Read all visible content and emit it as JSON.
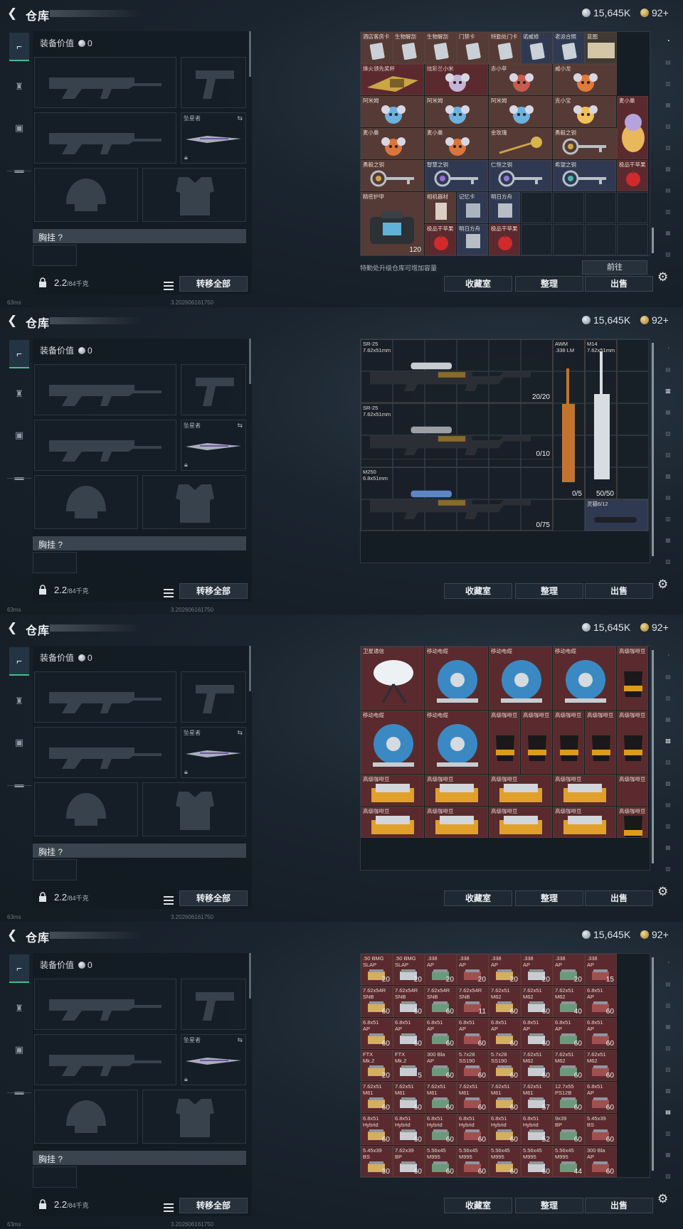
{
  "header": {
    "title": "仓库",
    "silver": "15,645K",
    "gold": "92+"
  },
  "gear": {
    "value_label": "装备价值",
    "value": "0",
    "knife_label": "坠星者",
    "chest_label": "胸挂 ?",
    "weight": "2.2",
    "weight_max": "/84千克",
    "transfer": "转移全部"
  },
  "status": {
    "ping": "63ms",
    "build": "3.202606161750"
  },
  "buttons": {
    "collection": "收藏室",
    "sort": "整理",
    "sell": "出售",
    "goto": "前往"
  },
  "upgrade_note": "特勤处升级仓库可增加容量",
  "views": [
    {
      "items": [
        {
          "n": "酒店客房卡",
          "c": "#563a36"
        },
        {
          "n": "生物解剖",
          "c": "#563a36"
        },
        {
          "n": "生物解剖",
          "c": "#563a36"
        },
        {
          "n": "门禁卡",
          "c": "#563a36"
        },
        {
          "n": "特勤处门卡",
          "c": "#563a36"
        },
        {
          "n": "诺威修",
          "c": "#2f3a52"
        },
        {
          "n": "老派合照",
          "c": "#2f3a52"
        },
        {
          "n": "蓝图",
          "c": "#3f3b33"
        },
        {
          "n": "烽火领先奖杯",
          "c": "#5a2a2e"
        },
        {
          "n": "炫彩兰小米",
          "c": "#5a2a2e"
        },
        {
          "n": "赤小苹",
          "c": "#563a36"
        },
        {
          "n": "威小龙",
          "c": "#563a36"
        },
        {
          "n": "阿米姆",
          "c": "#563a36"
        },
        {
          "n": "阿米姆",
          "c": "#563a36"
        },
        {
          "n": "阿米姆",
          "c": "#563a36"
        },
        {
          "n": "克小宝",
          "c": "#563a36"
        },
        {
          "n": "麦小巢",
          "c": "#5a2a2e"
        },
        {
          "n": "麦小巢",
          "c": "#563a36"
        },
        {
          "n": "麦小巢",
          "c": "#563a36"
        },
        {
          "n": "金玫瑰",
          "c": "#563a36"
        },
        {
          "n": "勇毅之钥",
          "c": "#563a36"
        },
        {
          "n": "勇毅之钥",
          "c": "#563a36"
        },
        {
          "n": "智慧之钥",
          "c": "#2f3a52"
        },
        {
          "n": "仁恒之钥",
          "c": "#2f3a52"
        },
        {
          "n": "希望之钥",
          "c": "#2f3a52"
        },
        {
          "n": "极品干苹果",
          "c": "#5a2a2e"
        },
        {
          "n": "精密护甲",
          "c": "#563a36",
          "count": "120"
        },
        {
          "n": "相机器材",
          "c": "#563a36"
        },
        {
          "n": "记忆卡",
          "c": "#2f3a52"
        },
        {
          "n": "明日方舟",
          "c": "#2f3a52"
        },
        {
          "n": "极品干苹果",
          "c": "#5a2a2e"
        },
        {
          "n": "明日方舟",
          "c": "#2f3a52"
        },
        {
          "n": "极品干苹果",
          "c": "#5a2a2e"
        }
      ]
    },
    {
      "items": [
        {
          "n": "SR-25",
          "sub": "7.62x51mm",
          "count": "20/20"
        },
        {
          "n": "SR-25",
          "sub": "7.62x51mm",
          "count": "0/10"
        },
        {
          "n": "M250",
          "sub": "6.8x51mm",
          "count": "0/75"
        },
        {
          "n": "AWM",
          "sub": ".338 LM",
          "count": "0/5"
        },
        {
          "n": "M14",
          "sub": "7.62x51mm",
          "count": "50/50"
        },
        {
          "n": "灵猫6/12",
          "sub": ""
        }
      ]
    },
    {
      "items": [
        {
          "n": "卫星通信"
        },
        {
          "n": "移动电缆"
        },
        {
          "n": "移动电缆"
        },
        {
          "n": "移动电缆"
        },
        {
          "n": "高级咖啡豆"
        },
        {
          "n": "移动电缆"
        },
        {
          "n": "移动电缆"
        },
        {
          "n": "高级咖啡豆"
        },
        {
          "n": "高级咖啡豆"
        },
        {
          "n": "高级咖啡豆"
        },
        {
          "n": "高级咖啡豆"
        },
        {
          "n": "高级咖啡豆"
        },
        {
          "n": "高级咖啡豆"
        },
        {
          "n": "高级咖啡豆"
        },
        {
          "n": "高级咖啡豆"
        },
        {
          "n": "高级咖啡豆"
        },
        {
          "n": "高级咖啡豆"
        },
        {
          "n": "高级咖啡豆"
        },
        {
          "n": "高级咖啡豆"
        },
        {
          "n": "高级咖啡豆"
        },
        {
          "n": "高级咖啡豆"
        },
        {
          "n": "高级咖啡豆"
        },
        {
          "n": "高级咖啡豆"
        },
        {
          "n": "高级咖啡豆"
        }
      ]
    },
    {
      "ammo": [
        [
          ".50 BMG",
          "SLAP",
          "20"
        ],
        [
          ".50 BMG",
          "SLAP",
          "20"
        ],
        [
          ".338",
          "AP",
          "20"
        ],
        [
          ".338",
          "AP",
          "20"
        ],
        [
          ".338",
          "AP",
          "20"
        ],
        [
          ".338",
          "AP",
          "20"
        ],
        [
          ".338",
          "AP",
          "20"
        ],
        [
          ".338",
          "AP",
          "15"
        ],
        [
          "7.62x54R",
          "SNB",
          "60"
        ],
        [
          "7.62x54R",
          "SNB",
          "60"
        ],
        [
          "7.62x54R",
          "SNB",
          "60"
        ],
        [
          "7.62x54R",
          "SNB",
          "11"
        ],
        [
          "7.62x51",
          "M62",
          "60"
        ],
        [
          "7.62x51",
          "M62",
          "60"
        ],
        [
          "7.62x51",
          "M62",
          "40"
        ],
        [
          "6.8x51",
          "AP",
          "60"
        ],
        [
          "6.8x51",
          "AP",
          "60"
        ],
        [
          "6.8x51",
          "AP",
          "60"
        ],
        [
          "6.8x51",
          "AP",
          "60"
        ],
        [
          "6.8x51",
          "AP",
          "60"
        ],
        [
          "6.8x51",
          "AP",
          "60"
        ],
        [
          "6.8x51",
          "AP",
          "60"
        ],
        [
          "6.8x51",
          "AP",
          "60"
        ],
        [
          "6.8x51",
          "AP",
          "60"
        ],
        [
          "FTX",
          "Mk.2",
          "20"
        ],
        [
          "FTX",
          "Mk.2",
          "5"
        ],
        [
          "300 Bla",
          "AP",
          "60"
        ],
        [
          "5.7x28",
          "SS190",
          "60"
        ],
        [
          "5.7x28",
          "SS190",
          "60"
        ],
        [
          "7.62x51",
          "M62",
          "60"
        ],
        [
          "7.62x51",
          "M62",
          "60"
        ],
        [
          "7.62x51",
          "M62",
          "60"
        ],
        [
          "7.62x51",
          "M61",
          "60"
        ],
        [
          "7.62x51",
          "M61",
          "60"
        ],
        [
          "7.62x51",
          "M61",
          "60"
        ],
        [
          "7.62x51",
          "M61",
          "60"
        ],
        [
          "7.62x51",
          "M61",
          "60"
        ],
        [
          "7.62x51",
          "M61",
          "57"
        ],
        [
          "12.7x55",
          "PS12B",
          "60"
        ],
        [
          "6.8x51",
          "AP",
          "60"
        ],
        [
          "6.8x51",
          "Hybrid",
          "60"
        ],
        [
          "6.8x51",
          "Hybrid",
          "60"
        ],
        [
          "6.8x51",
          "Hybrid",
          "60"
        ],
        [
          "6.8x51",
          "Hybrid",
          "60"
        ],
        [
          "6.8x51",
          "Hybrid",
          "60"
        ],
        [
          "6.8x51",
          "Hybrid",
          "52"
        ],
        [
          "9x39",
          "BP",
          "60"
        ],
        [
          "5.45x39",
          "BS",
          "60"
        ],
        [
          "5.45x39",
          "BS",
          "30"
        ],
        [
          "7.62x39",
          "BP",
          "60"
        ],
        [
          "5.56x45",
          "M995",
          "60"
        ],
        [
          "5.56x45",
          "M995",
          "60"
        ],
        [
          "5.56x45",
          "M995",
          "60"
        ],
        [
          "5.56x45",
          "M995",
          "60"
        ],
        [
          "5.56x45",
          "M995",
          "44"
        ],
        [
          "300 Bla",
          "AP",
          "60"
        ],
        [
          "300 Bla",
          "BPZ",
          "60"
        ],
        [
          "300 Bla",
          "BPZ",
          "60"
        ],
        [
          "300 Bla",
          "BPZ",
          "60"
        ],
        [
          "300 Bla",
          "BPZ",
          "60"
        ],
        [
          "4.6x30",
          "AP",
          "60"
        ],
        [
          "4.6x30",
          "AP",
          "60"
        ],
        [
          ".45",
          "AP",
          "60"
        ],
        [
          ".45",
          "AP",
          "60"
        ]
      ]
    }
  ]
}
